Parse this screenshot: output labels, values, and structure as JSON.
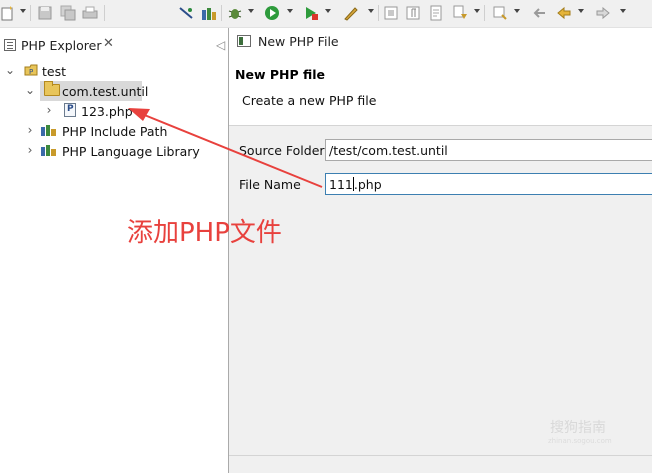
{
  "explorer": {
    "tab_title": "PHP Explorer",
    "close_glyph": "✕",
    "tree": {
      "project": "test",
      "folder": "com.test.until",
      "file": "123.php",
      "include_path": "PHP Include Path",
      "library": "PHP Language Library"
    }
  },
  "annotation": {
    "text": "添加PHP文件",
    "color": "#e8413d"
  },
  "dialog": {
    "window_title": "New PHP File",
    "header_title": "New PHP file",
    "header_desc": "Create a new PHP file",
    "source_folder_label": "Source Folder",
    "source_folder_value": "/test/com.test.until",
    "file_name_label": "File Name",
    "file_name_before_caret": "111",
    "file_name_after_caret": ".php"
  },
  "watermark": {
    "text": "搜狗指南",
    "sub": "zhinan.sogou.com"
  },
  "icons": [
    "new-file-icon",
    "save-icon",
    "save-all-icon",
    "print-icon",
    "debug-icon",
    "run-icon",
    "external-tool-icon",
    "search-icon",
    "back-icon",
    "forward-icon"
  ]
}
